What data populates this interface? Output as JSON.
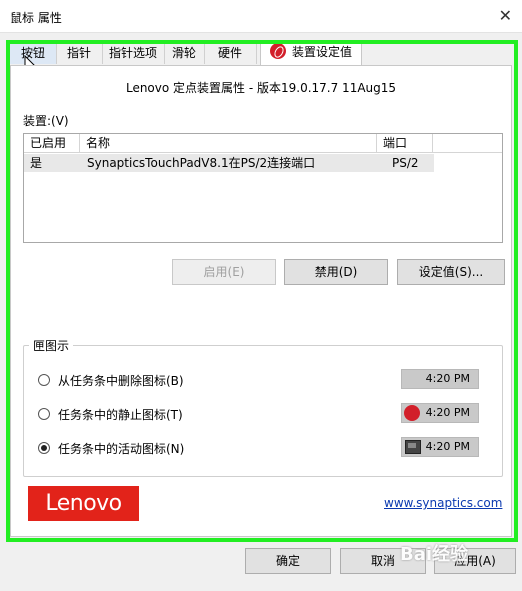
{
  "window": {
    "title": "鼠标 属性",
    "close_glyph": "✕"
  },
  "tabs": [
    {
      "label": "按钮"
    },
    {
      "label": "指针"
    },
    {
      "label": "指针选项"
    },
    {
      "label": "滑轮"
    },
    {
      "label": "硬件"
    },
    {
      "label": "装置设定值",
      "icon": "synaptics-icon",
      "active": true
    }
  ],
  "header": {
    "text": "Lenovo 定点装置属性 - 版本19.0.17.7 11Aug15"
  },
  "devices": {
    "label": "装置:(V)",
    "columns": [
      "已启用",
      "名称",
      "端口"
    ],
    "rows": [
      {
        "enabled": "是",
        "name": "SynapticsTouchPadV8.1在PS/2连接端口",
        "port": "PS/2"
      }
    ]
  },
  "buttons": {
    "enable": "启用(E)",
    "disable": "禁用(D)",
    "settings": "设定值(S)..."
  },
  "tray_group": {
    "title": "匣图示",
    "options": [
      {
        "label": "从任务条中删除图标(B)",
        "checked": false,
        "time": "4:20 PM",
        "icon": ""
      },
      {
        "label": "任务条中的静止图标(T)",
        "checked": false,
        "time": "4:20 PM",
        "icon": "synaptics-tray-icon"
      },
      {
        "label": "任务条中的活动图标(N)",
        "checked": true,
        "time": "4:20 PM",
        "icon": "touchpad-tray-icon"
      }
    ]
  },
  "brand": {
    "logo_text": "Lenovo",
    "link": "www.synaptics.com"
  },
  "footer": {
    "ok": "确定",
    "cancel": "取消",
    "apply": "应用(A)"
  },
  "watermark": "Bai经验",
  "colors": {
    "highlight_frame": "#22ee22",
    "lenovo_red": "#e2231a",
    "link": "#0a39b0"
  }
}
